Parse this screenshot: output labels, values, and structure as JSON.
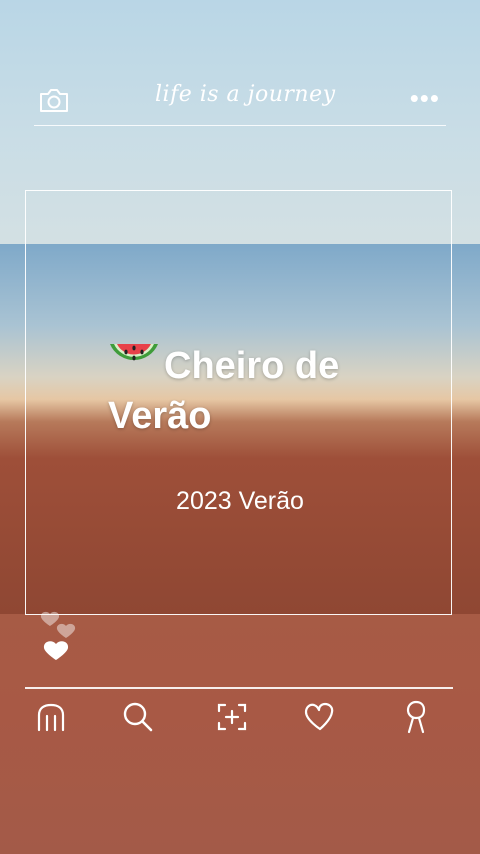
{
  "header": {
    "tagline": "life is a journey",
    "camera_icon": "camera-icon",
    "more_icon": "more-dots-icon"
  },
  "post": {
    "title_line1": "Cheiro de",
    "title_line2": "Verão",
    "title_emoji_icon": "watermelon-icon",
    "subtitle": "2023 Verão"
  },
  "nav": {
    "items": [
      {
        "icon": "home-icon"
      },
      {
        "icon": "search-icon"
      },
      {
        "icon": "add-post-icon"
      },
      {
        "icon": "heart-icon"
      },
      {
        "icon": "profile-icon"
      }
    ]
  },
  "colors": {
    "accent": "#ffffff",
    "earth": "#a85a47",
    "sky": "#b9d6e6"
  }
}
